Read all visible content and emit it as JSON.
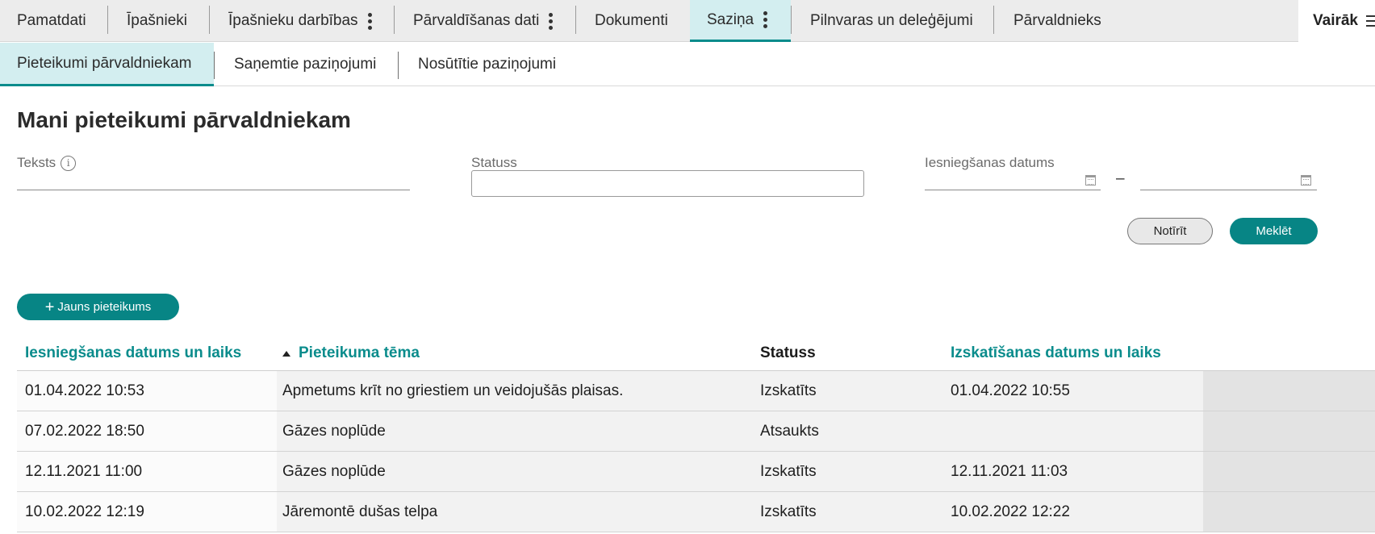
{
  "topnav": {
    "tabs": [
      {
        "label": "Pamatdati"
      },
      {
        "label": "Īpašnieki"
      },
      {
        "label": "Īpašnieku darbības"
      },
      {
        "label": "Pārvaldīšanas dati"
      },
      {
        "label": "Dokumenti"
      },
      {
        "label": "Saziņa"
      },
      {
        "label": "Pilnvaras un deleģējumi"
      },
      {
        "label": "Pārvaldnieks"
      }
    ],
    "active_tab": "Saziņa",
    "more_label": "Vairāk"
  },
  "subnav": {
    "tabs": [
      {
        "label": "Pieteikumi pārvaldniekam"
      },
      {
        "label": "Saņemtie paziņojumi"
      },
      {
        "label": "Nosūtītie paziņojumi"
      }
    ],
    "active_tab": "Pieteikumi pārvaldniekam"
  },
  "page_title": "Mani pieteikumi pārvaldniekam",
  "filters": {
    "text_label": "Teksts",
    "text_value": "",
    "status_label": "Statuss",
    "status_value": "",
    "date_label": "Iesniegšanas datums",
    "date_from": "",
    "date_to": "",
    "date_separator": "–"
  },
  "buttons": {
    "clear": "Notīrīt",
    "search": "Meklēt",
    "new_request": "Jauns pieteikums"
  },
  "table": {
    "columns": [
      "Iesniegšanas datums un laiks",
      "Pieteikuma tēma",
      "Statuss",
      "Izskatīšanas datums un laiks"
    ],
    "sort_column": "Pieteikuma tēma",
    "sort_direction": "ascending",
    "rows": [
      {
        "submitted": "01.04.2022 10:53",
        "topic": "Apmetums krīt no griestiem un veidojušās plaisas.",
        "status": "Izskatīts",
        "reviewed": "01.04.2022 10:55"
      },
      {
        "submitted": "07.02.2022 18:50",
        "topic": "Gāzes noplūde",
        "status": "Atsaukts",
        "reviewed": ""
      },
      {
        "submitted": "12.11.2021 11:00",
        "topic": "Gāzes noplūde",
        "status": "Izskatīts",
        "reviewed": "12.11.2021 11:03"
      },
      {
        "submitted": "10.02.2022 12:19",
        "topic": "Jāremontē dušas telpa",
        "status": "Izskatīts",
        "reviewed": "10.02.2022 12:22"
      }
    ]
  },
  "colors": {
    "accent": "#078585",
    "active_tab_bg": "#d3eef0",
    "nav_bg": "#ececec"
  },
  "icons": [
    "kebab-menu-icon",
    "hamburger-menu-icon",
    "info-icon",
    "calendar-icon",
    "plus-icon",
    "sort-ascending-icon"
  ]
}
